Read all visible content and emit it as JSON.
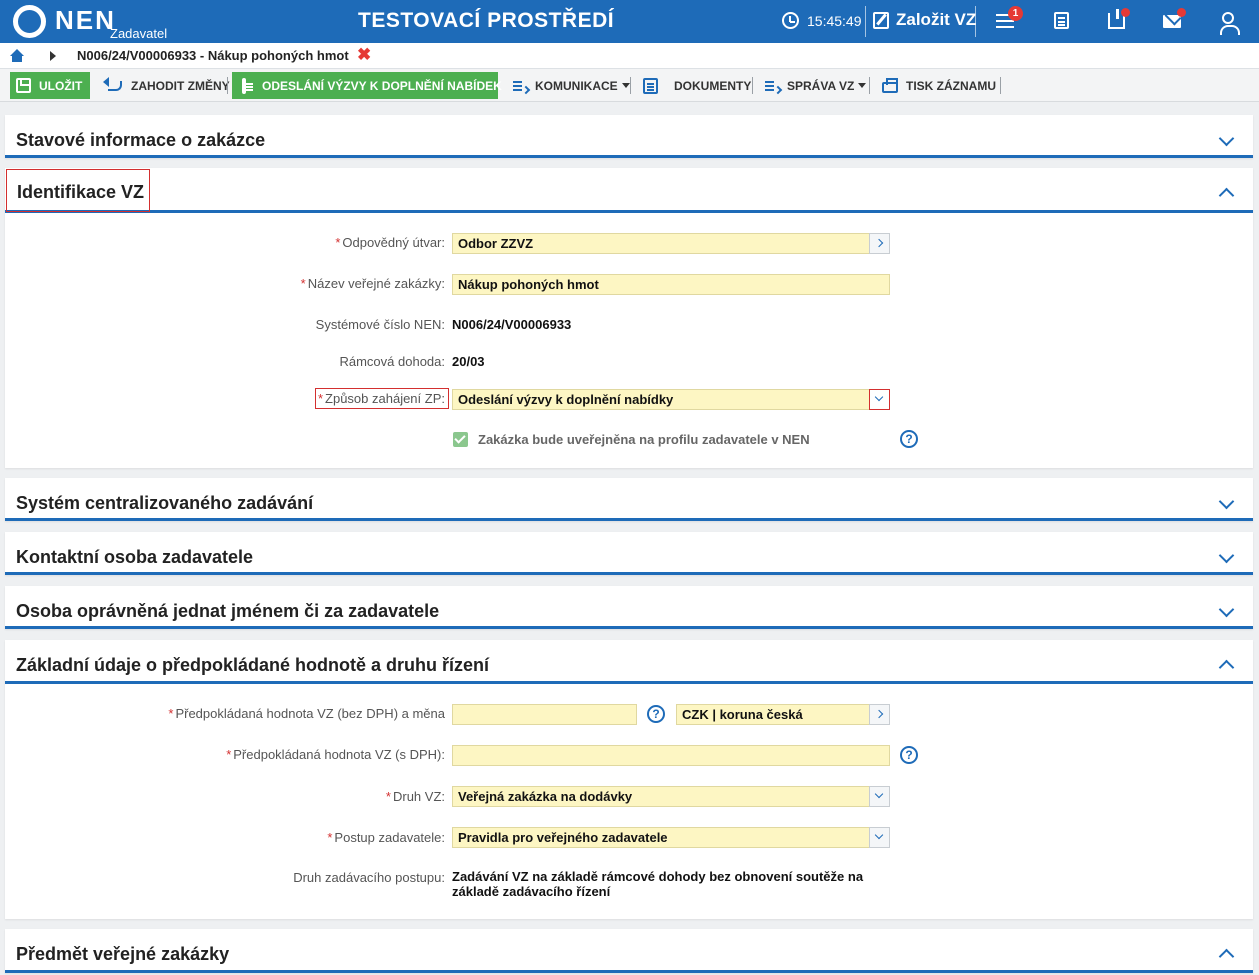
{
  "topbar": {
    "logo": "NEN",
    "logo_sub": "Zadavatel",
    "env_title": "TESTOVACÍ PROSTŘEDÍ",
    "clock": "15:45:49",
    "create_vz": "Založit VZ",
    "menu_badge": "1",
    "color": "#1e6bb8"
  },
  "breadcrumb": {
    "current": "N006/24/V00006933 - Nákup pohoných hmot"
  },
  "toolbar": {
    "save": "ULOŽIT",
    "discard": "ZAHODIT ZMĚNY",
    "send_invitation": "ODESLÁNÍ VÝZVY K DOPLNĚNÍ NABÍDEK",
    "communication": "KOMUNIKACE",
    "documents": "DOKUMENTY",
    "vz_management": "SPRÁVA VZ",
    "print": "TISK ZÁZNAMU"
  },
  "sections": {
    "status": "Stavové informace o zakázce",
    "identification": "Identifikace VZ",
    "centralized": "Systém centralizovaného zadávání",
    "contact": "Kontaktní osoba zadavatele",
    "authorized": "Osoba oprávněná jednat jménem či za zadavatele",
    "basic": "Základní údaje o předpokládané hodnotě a druhu řízení",
    "subject": "Předmět veřejné zakázky"
  },
  "identification": {
    "unit_label": "Odpovědný útvar:",
    "unit_value": "Odbor ZZVZ",
    "name_label": "Název veřejné zakázky:",
    "name_value": "Nákup pohoných hmot",
    "sysnum_label": "Systémové číslo NEN:",
    "sysnum_value": "N006/24/V00006933",
    "framework_label": "Rámcová dohoda:",
    "framework_value": "20/03",
    "method_label": "Způsob zahájení ZP:",
    "method_value": "Odeslání výzvy k doplnění nabídky",
    "publish_label": "Zakázka bude uveřejněna na profilu zadavatele v NEN",
    "publish_checked": true
  },
  "basic": {
    "value_label": "Předpokládaná hodnota VZ (bez DPH) a měna",
    "value_value": "",
    "currency_value": "CZK | koruna česká",
    "value_vat_label": "Předpokládaná hodnota VZ (s DPH):",
    "value_vat_value": "",
    "type_label": "Druh VZ:",
    "type_value": "Veřejná zakázka na dodávky",
    "procedure_label": "Postup zadavatele:",
    "procedure_value": "Pravidla pro veřejného zadavatele",
    "procedure_kind_label": "Druh zadávacího postupu:",
    "procedure_kind_value": "Zadávání VZ na základě rámcové dohody bez obnovení soutěže na základě zadávacího řízení"
  },
  "icons": {
    "help": "?",
    "close": "✖",
    "required": "*"
  }
}
